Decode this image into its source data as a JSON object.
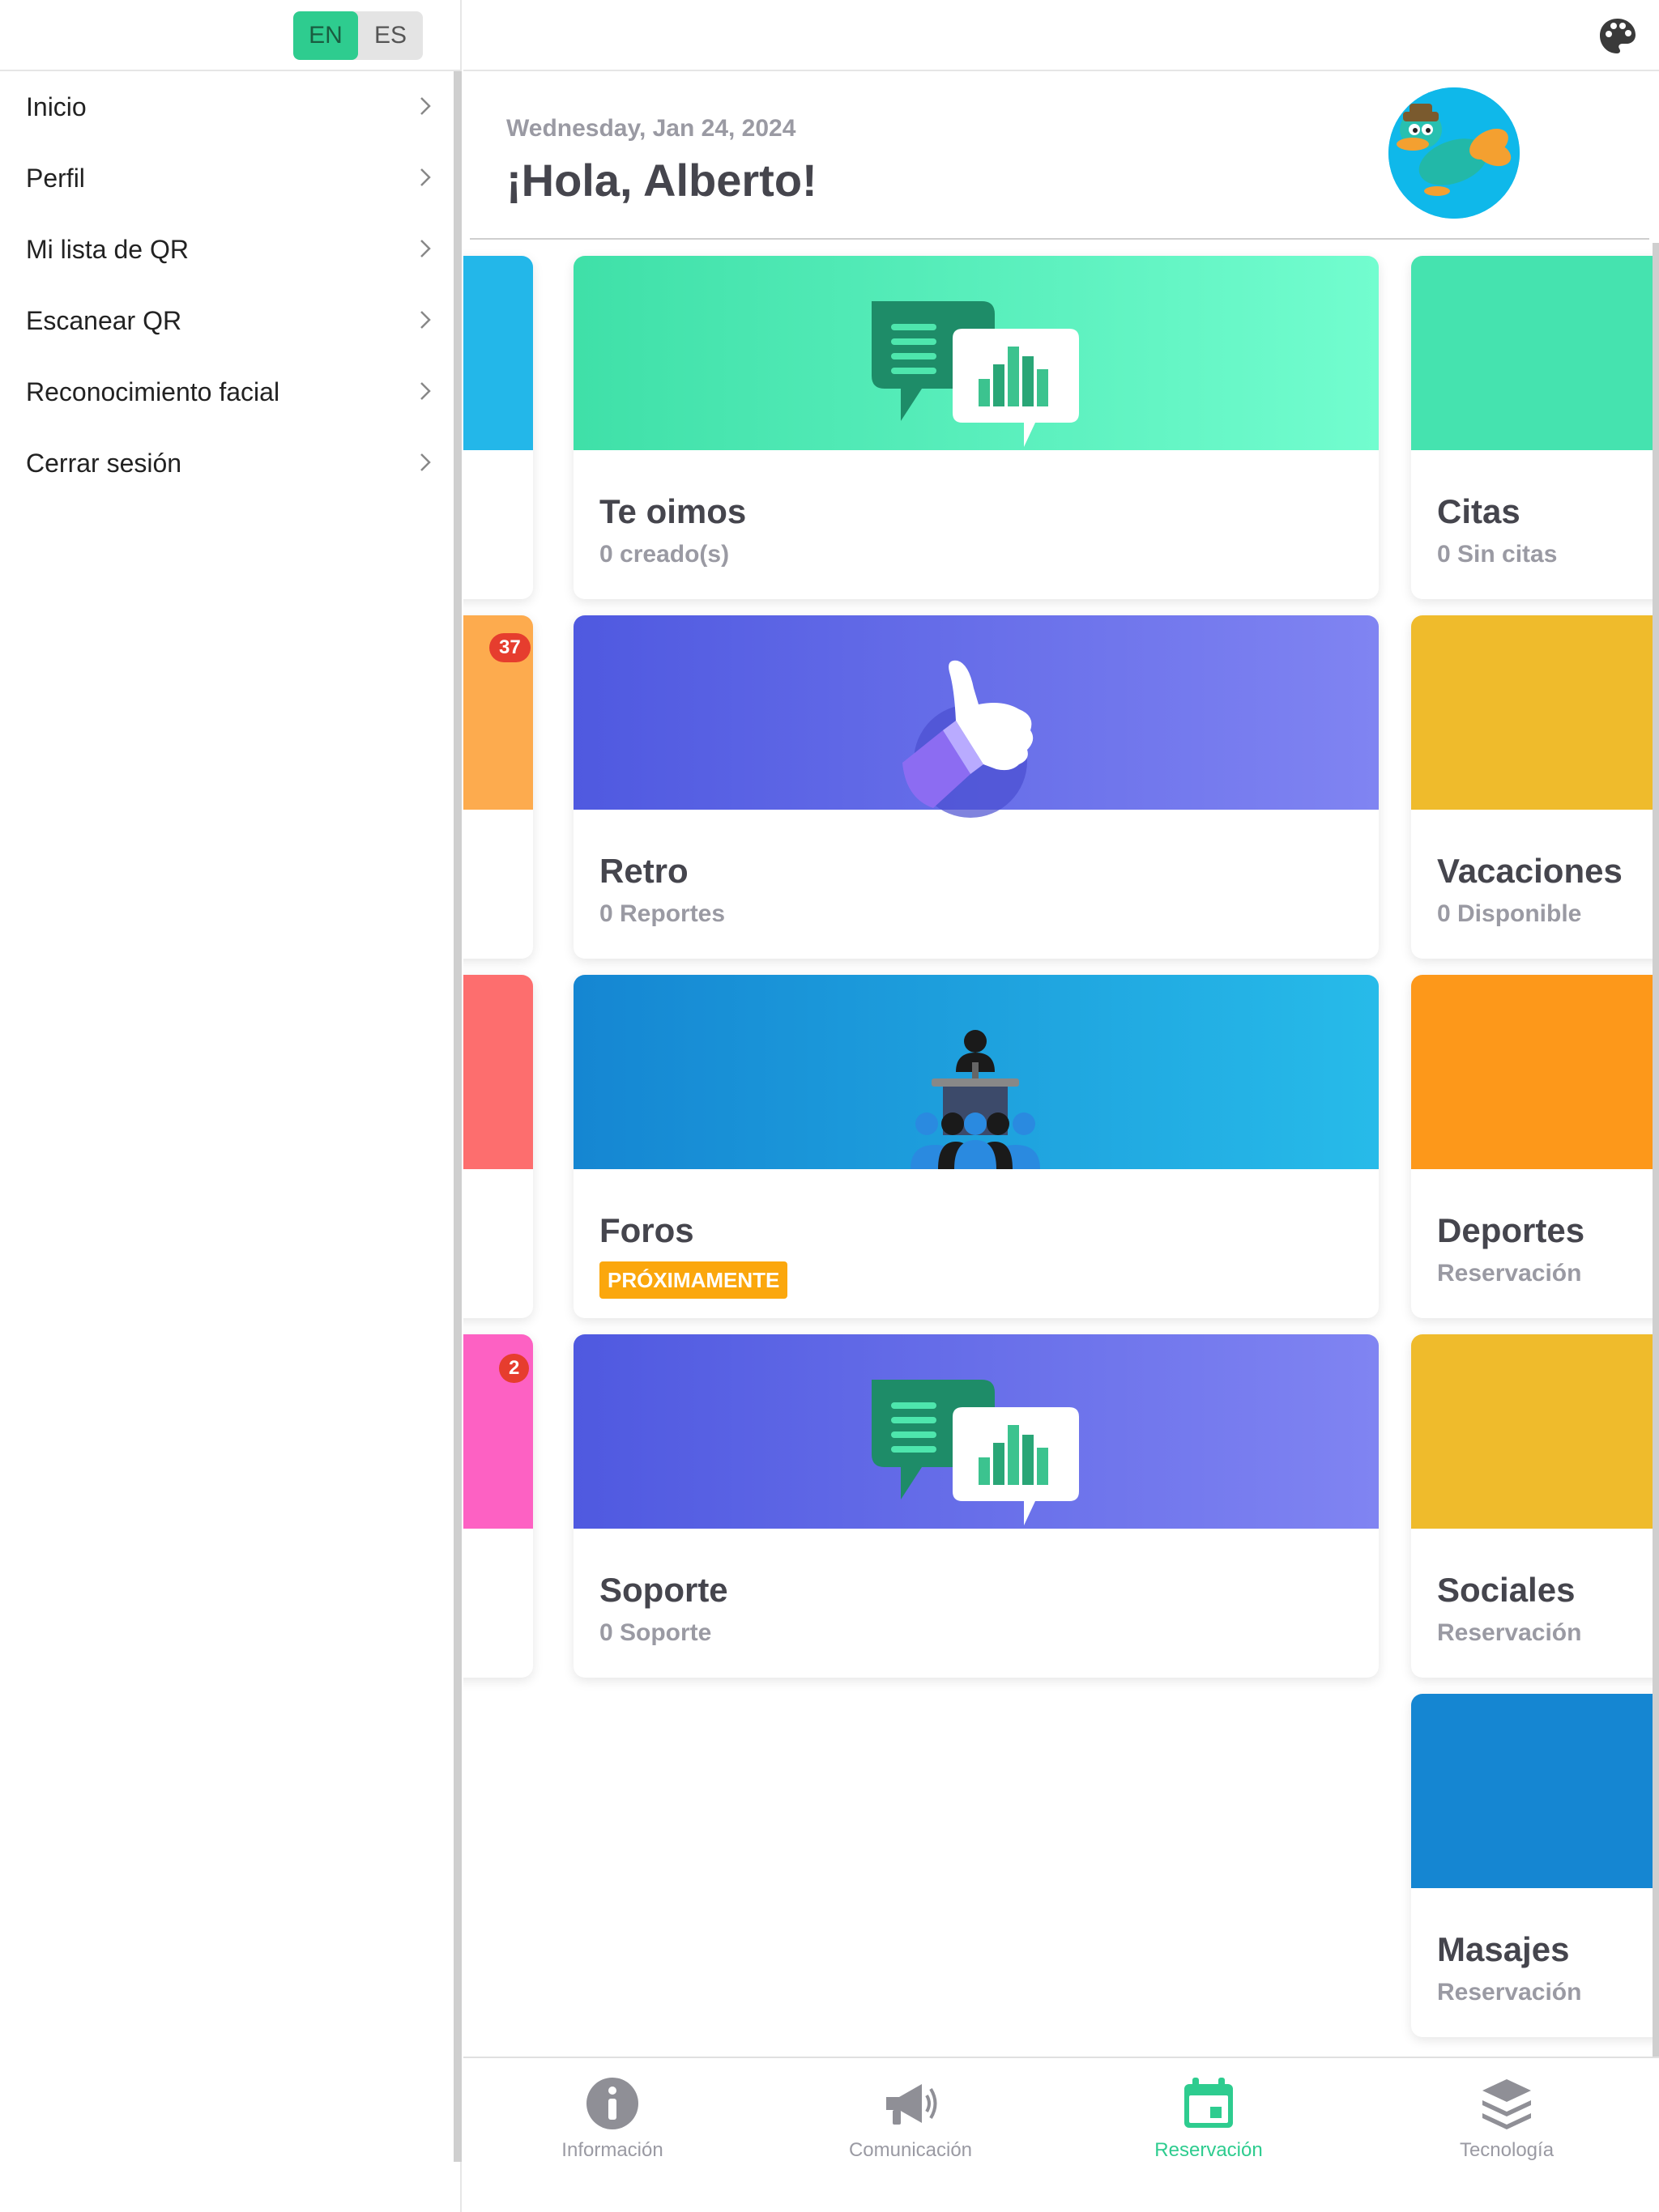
{
  "language": {
    "options": [
      "EN",
      "ES"
    ],
    "selected": "EN"
  },
  "sidebar": {
    "items": [
      {
        "label": "Inicio"
      },
      {
        "label": "Perfil"
      },
      {
        "label": "Mi lista de QR"
      },
      {
        "label": "Escanear QR"
      },
      {
        "label": "Reconocimiento facial"
      },
      {
        "label": "Cerrar sesión"
      }
    ]
  },
  "header": {
    "date": "Wednesday, Jan 24, 2024",
    "greeting": "¡Hola, Alberto!"
  },
  "cards_center": [
    {
      "title": "Te oimos",
      "subtitle": "0 creado(s)",
      "banner": "green",
      "icon": "chat-chart-icon"
    },
    {
      "title": "Retro",
      "subtitle": "0 Reportes",
      "banner": "purple",
      "icon": "thumbs-up-icon"
    },
    {
      "title": "Foros",
      "badge": "PRÓXIMAMENTE",
      "banner": "blue",
      "icon": "podium-audience-icon"
    },
    {
      "title": "Soporte",
      "subtitle": "0 Soporte",
      "banner": "purple",
      "icon": "chat-chart-icon"
    }
  ],
  "cards_right": [
    {
      "title": "Citas",
      "subtitle": "0 Sin citas",
      "banner": "green"
    },
    {
      "title": "Vacaciones",
      "subtitle": "0 Disponible",
      "banner": "yellow"
    },
    {
      "title": "Deportes",
      "subtitle": "Reservación",
      "banner": "orange"
    },
    {
      "title": "Sociales",
      "subtitle": "Reservación",
      "banner": "yellow"
    },
    {
      "title": "Masajes",
      "subtitle": "Reservación",
      "banner": "blue"
    }
  ],
  "cards_left_badges": [
    "37",
    "2"
  ],
  "bottom_nav": {
    "items": [
      {
        "label": "Información",
        "icon": "info-icon"
      },
      {
        "label": "Comunicación",
        "icon": "megaphone-icon"
      },
      {
        "label": "Reservación",
        "icon": "calendar-icon"
      },
      {
        "label": "Tecnología",
        "icon": "layers-icon"
      }
    ],
    "active": "Reservación"
  },
  "colors": {
    "accent": "#2ecc8f",
    "text_dark": "#45454d",
    "text_muted": "#9a9aa3",
    "badge_red": "#e63d2e",
    "badge_orange": "#fba70d"
  }
}
